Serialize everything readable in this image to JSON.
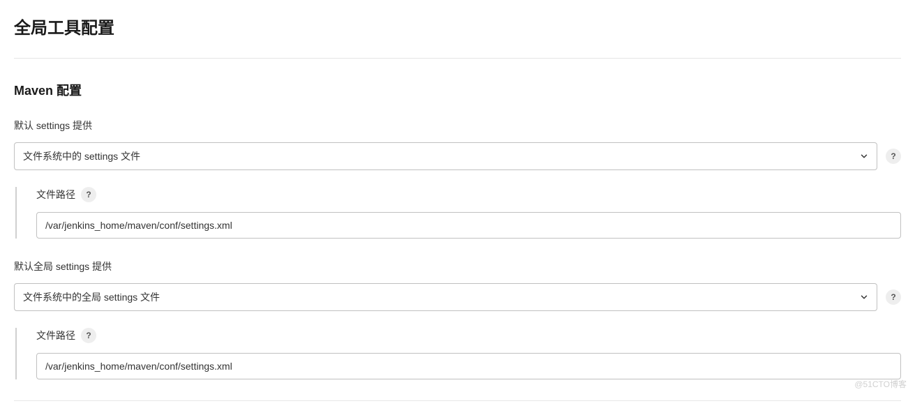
{
  "page": {
    "title": "全局工具配置",
    "section_title": "Maven 配置"
  },
  "maven": {
    "default_settings": {
      "label": "默认 settings 提供",
      "selected": "文件系统中的 settings 文件",
      "file_path_label": "文件路径",
      "file_path_value": "/var/jenkins_home/maven/conf/settings.xml"
    },
    "global_settings": {
      "label": "默认全局 settings 提供",
      "selected": "文件系统中的全局 settings 文件",
      "file_path_label": "文件路径",
      "file_path_value": "/var/jenkins_home/maven/conf/settings.xml"
    }
  },
  "help_glyph": "?",
  "watermark": "@51CTO博客"
}
